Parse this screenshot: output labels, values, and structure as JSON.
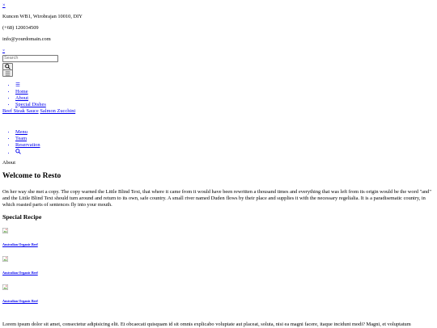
{
  "top_close": "×",
  "contact": {
    "address": "Kuncen WB1, Wirobrajan 10010, DIY",
    "phone": "(+68) 120034509",
    "email": "info@yourdomain.com"
  },
  "search": {
    "close": "×",
    "placeholder": "Search"
  },
  "nav": {
    "items": [
      "Home",
      "About",
      "Special Dishes"
    ],
    "submenu": [
      "Beef Steak Sauce",
      "Salmon Zucchini"
    ],
    "items2": [
      "Menu",
      "Team",
      "Reservation"
    ]
  },
  "breadcrumb": "About",
  "page_title": "Welcome to Resto",
  "intro": "On her way she met a copy. The copy warned the Little Blind Text, that where it came from it would have been rewritten a thousand times and everything that was left from its origin would be the word \"and\" and the Little Blind Text should turn around and return to its own, safe country. A small river named Duden flows by their place and supplies it with the necessary regelialia. It is a paradisematic country, in which roasted parts of sentences fly into your mouth.",
  "special_heading": "Special Recipe",
  "recipes": [
    "Australian Organic Beef",
    "Australian Organic Beef",
    "Australian Organic Beef"
  ],
  "lorem": "Lorem ipsum dolor sit amet, consectetur adipisicing elit. Et obcaecati quisquam id sit omnis explicabo voluptate aut placeat, soluta, nisi ea magni facere, itaque incidunt modi? Magni, et voluptatum"
}
